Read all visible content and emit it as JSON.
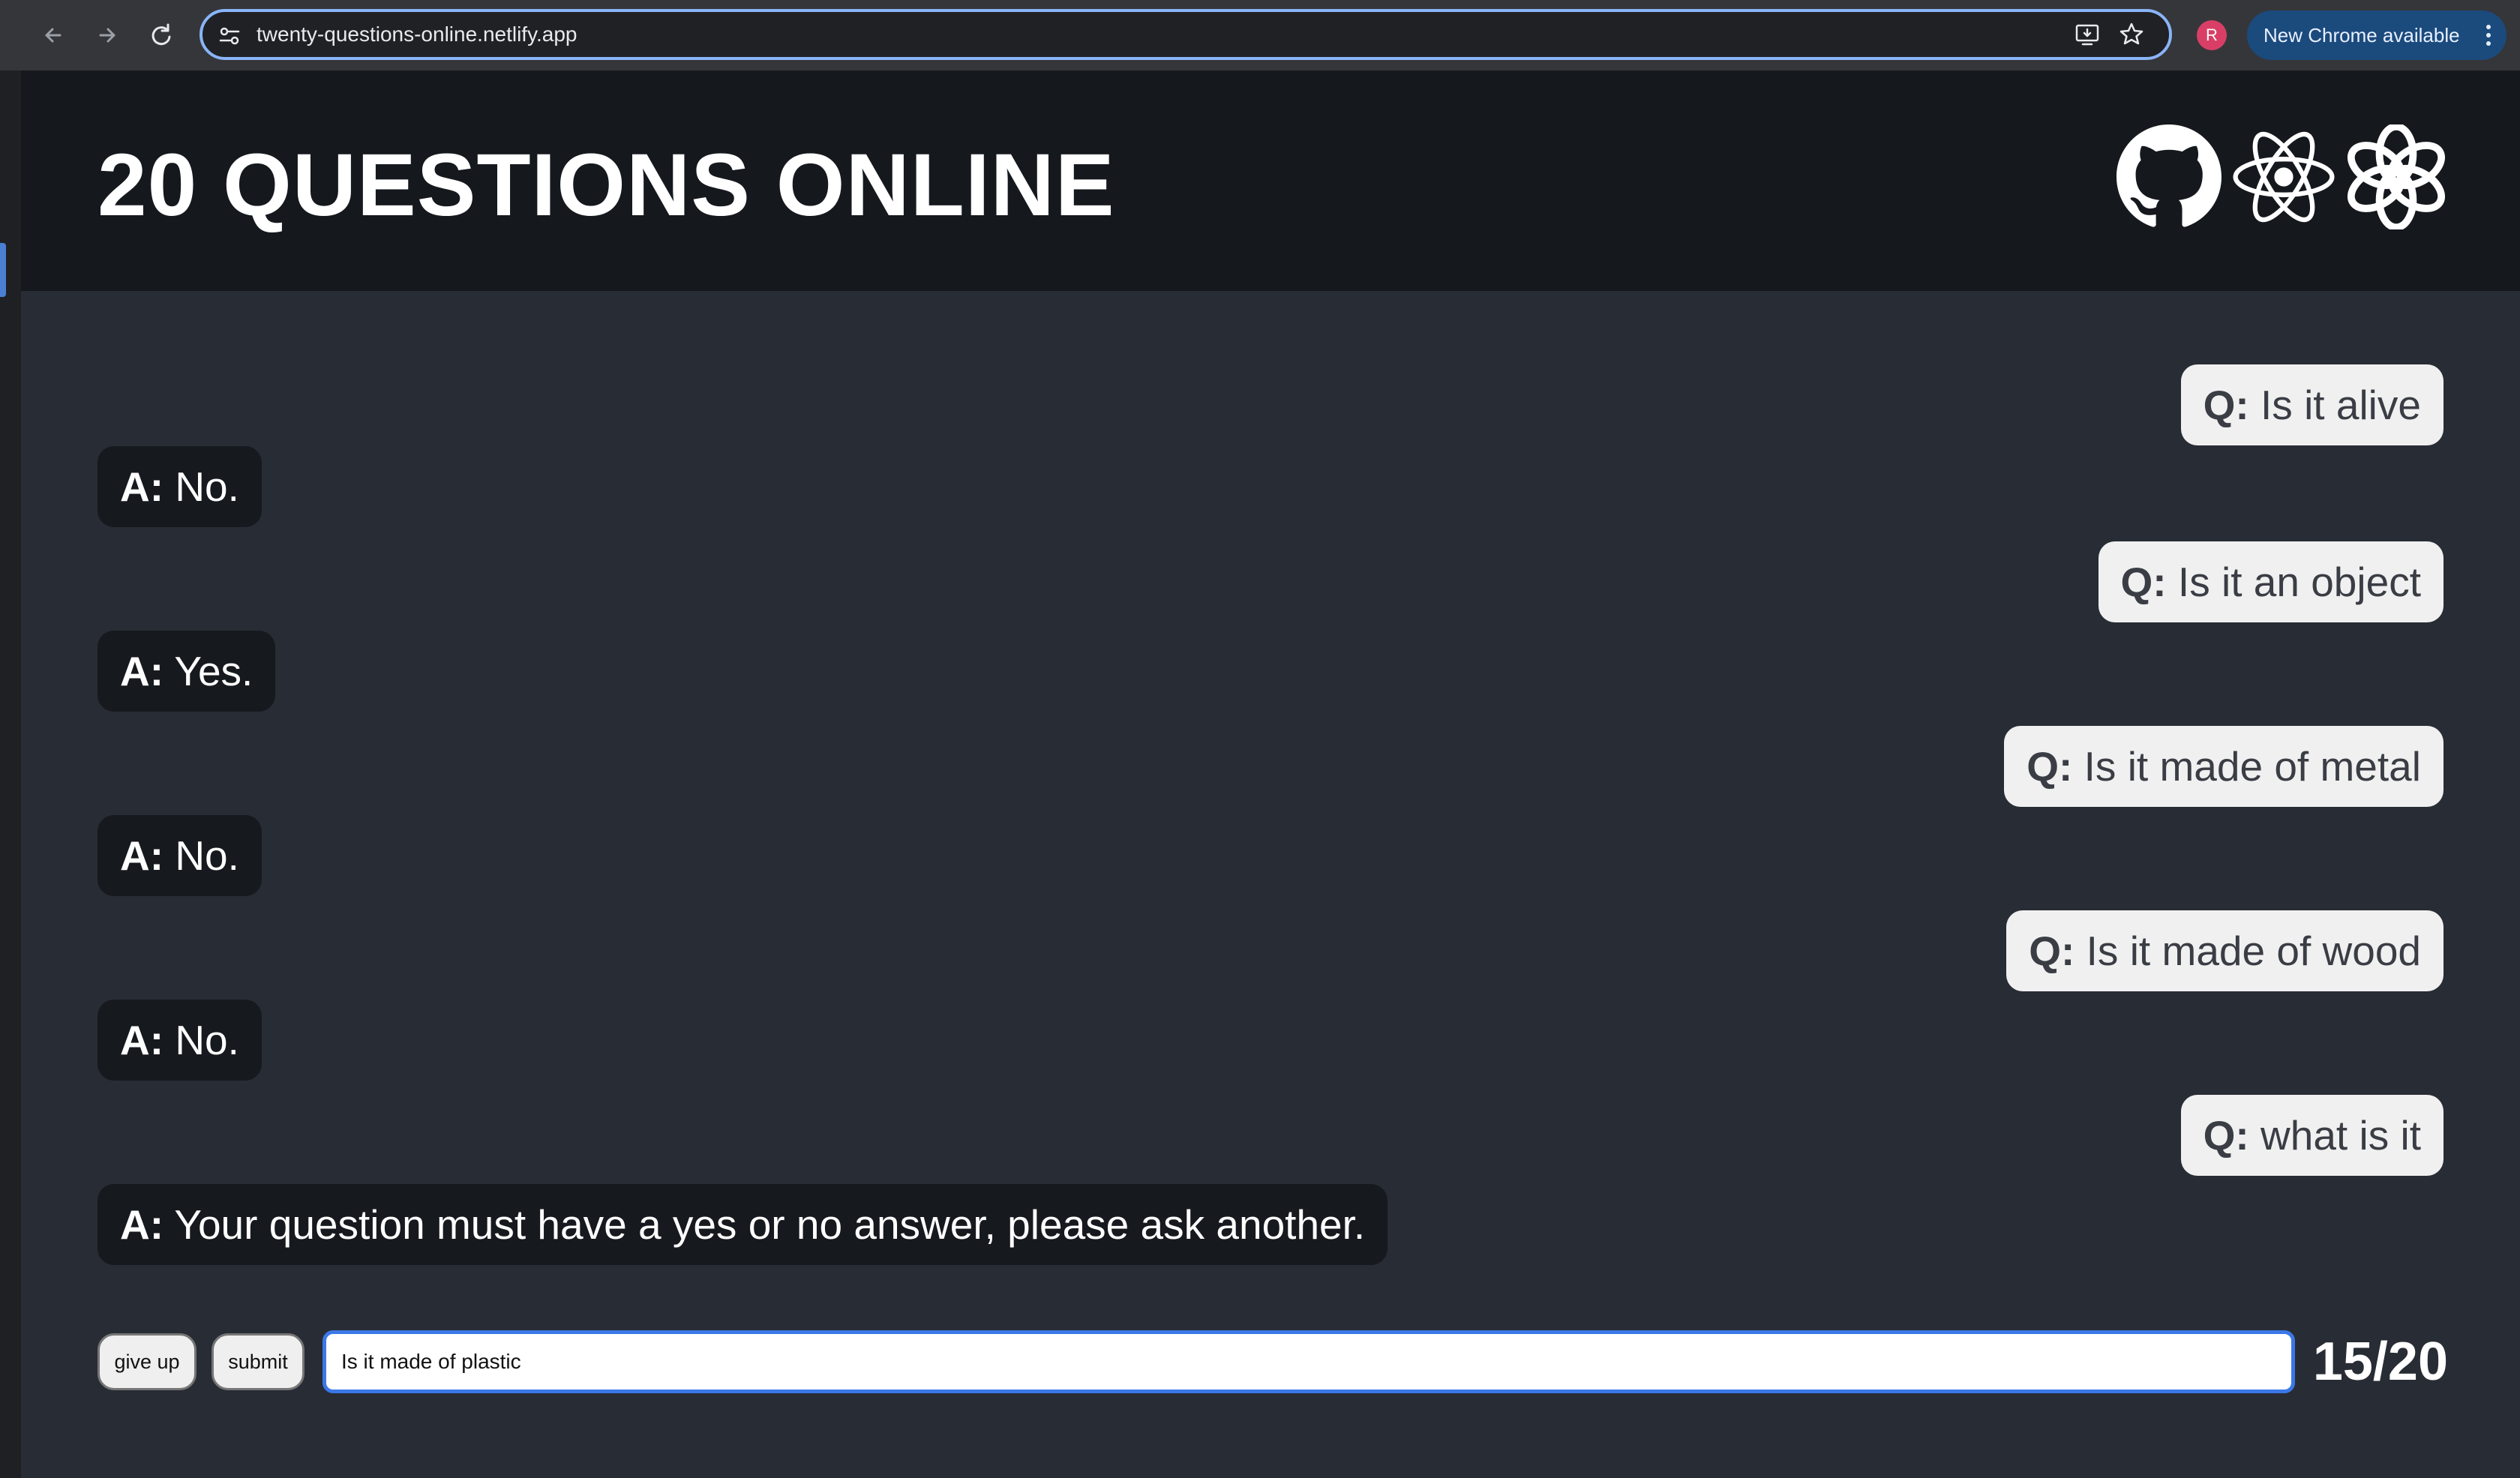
{
  "browser": {
    "url": "twenty-questions-online.netlify.app",
    "profile_initial": "R",
    "update_label": "New Chrome available"
  },
  "header": {
    "title": "20 QUESTIONS ONLINE",
    "icons": [
      "github-icon",
      "react-atom-icon",
      "openai-icon"
    ]
  },
  "conversation": [
    {
      "role": "question",
      "prefix": "Q:",
      "text": " Is it alive"
    },
    {
      "role": "answer",
      "prefix": "A:",
      "text": " No."
    },
    {
      "role": "question",
      "prefix": "Q:",
      "text": " Is it an object"
    },
    {
      "role": "answer",
      "prefix": "A:",
      "text": " Yes."
    },
    {
      "role": "question",
      "prefix": "Q:",
      "text": " Is it made of metal"
    },
    {
      "role": "answer",
      "prefix": "A:",
      "text": " No."
    },
    {
      "role": "question",
      "prefix": "Q:",
      "text": " Is it made of wood"
    },
    {
      "role": "answer",
      "prefix": "A:",
      "text": " No."
    },
    {
      "role": "question",
      "prefix": "Q:",
      "text": " what is it"
    },
    {
      "role": "answer",
      "prefix": "A:",
      "text": " Your question must have a yes or no answer, please ask another."
    }
  ],
  "controls": {
    "give_up_label": "give up",
    "submit_label": "submit",
    "input_value": "Is it made of plastic",
    "counter": "15/20"
  }
}
